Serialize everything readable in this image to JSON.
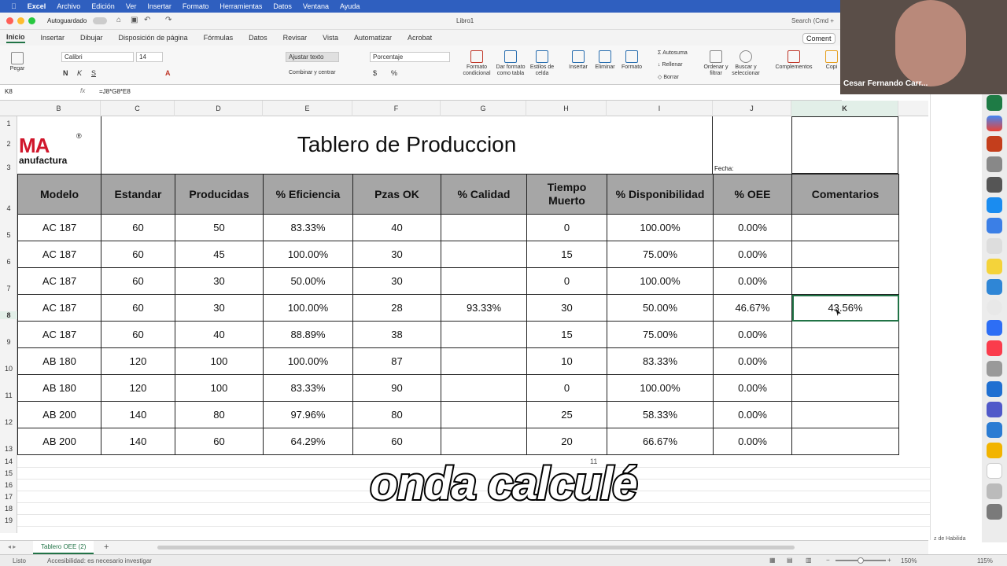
{
  "menubar": {
    "items": [
      "Excel",
      "Archivo",
      "Edición",
      "Ver",
      "Insertar",
      "Formato",
      "Herramientas",
      "Datos",
      "Ventana",
      "Ayuda"
    ],
    "search": "Search (Cmd +"
  },
  "titlebar": {
    "autosave": "Autoguardado",
    "doc_title": "Libro1"
  },
  "ribbon_tabs": [
    "Inicio",
    "Insertar",
    "Dibujar",
    "Disposición de página",
    "Fórmulas",
    "Datos",
    "Revisar",
    "Vista",
    "Automatizar",
    "Acrobat"
  ],
  "comments_btn": "Coment",
  "ribbon": {
    "paste": "Pegar",
    "font": "Calibri",
    "size": "14",
    "wrap": "Ajustar texto",
    "merge": "Combinar y centrar",
    "number_format": "Porcentaje",
    "cond_format": "Formato condicional",
    "table_format": "Dar formato como tabla",
    "cell_styles": "Estilos de celda",
    "insert": "Insertar",
    "delete": "Eliminar",
    "format": "Formato",
    "autosum": "Autosuma",
    "fill": "Rellenar",
    "clear": "Borrar",
    "sort": "Ordenar y filtrar",
    "find": "Buscar y seleccionar",
    "addins": "Complementos",
    "copilot": "Copi"
  },
  "formula": {
    "cell": "K8",
    "fx": "fx",
    "value": "=J8*G8*E8"
  },
  "columns": [
    "B",
    "C",
    "D",
    "E",
    "F",
    "G",
    "H",
    "I",
    "J",
    "K"
  ],
  "rows": [
    "1",
    "2",
    "3",
    "4",
    "5",
    "6",
    "7",
    "8",
    "9",
    "10",
    "11",
    "12",
    "13",
    "14",
    "15",
    "16",
    "17",
    "18",
    "19"
  ],
  "sheet": {
    "logo_top": "MA",
    "logo_bottom": "anufactura",
    "logo_reg": "®",
    "title": "Tablero de Produccion",
    "fecha": "Fecha:",
    "headers": [
      "Modelo",
      "Estandar",
      "Producidas",
      "% Eficiencia",
      "Pzas OK",
      "% Calidad",
      "Tiempo Muerto",
      "% Disponibilidad",
      "% OEE",
      "Comentarios"
    ],
    "data": [
      [
        "AC 187",
        "60",
        "50",
        "83.33%",
        "40",
        "",
        "0",
        "100.00%",
        "0.00%",
        ""
      ],
      [
        "AC 187",
        "60",
        "45",
        "100.00%",
        "30",
        "",
        "15",
        "75.00%",
        "0.00%",
        ""
      ],
      [
        "AC 187",
        "60",
        "30",
        "50.00%",
        "30",
        "",
        "0",
        "100.00%",
        "0.00%",
        ""
      ],
      [
        "AC 187",
        "60",
        "30",
        "100.00%",
        "28",
        "93.33%",
        "30",
        "50.00%",
        "46.67%",
        "43.56%"
      ],
      [
        "AC 187",
        "60",
        "40",
        "88.89%",
        "38",
        "",
        "15",
        "75.00%",
        "0.00%",
        ""
      ],
      [
        "AB 180",
        "120",
        "100",
        "100.00%",
        "87",
        "",
        "10",
        "83.33%",
        "0.00%",
        ""
      ],
      [
        "AB 180",
        "120",
        "100",
        "83.33%",
        "90",
        "",
        "0",
        "100.00%",
        "0.00%",
        ""
      ],
      [
        "AB 200",
        "140",
        "80",
        "97.96%",
        "80",
        "",
        "25",
        "58.33%",
        "0.00%",
        ""
      ],
      [
        "AB 200",
        "140",
        "60",
        "64.29%",
        "60",
        "",
        "20",
        "66.67%",
        "0.00%",
        ""
      ]
    ],
    "row14_fragment": "11"
  },
  "sheet_tab": "Tablero OEE (2)",
  "right_pane_text": "z de Habilida",
  "status": {
    "ready": "Listo",
    "accessibility": "Accesibilidad: es necesario investigar",
    "zoom": "150%",
    "zoom2": "115%"
  },
  "video": {
    "name": "Cesar Fernando Carr..."
  },
  "caption": "onda calculé"
}
